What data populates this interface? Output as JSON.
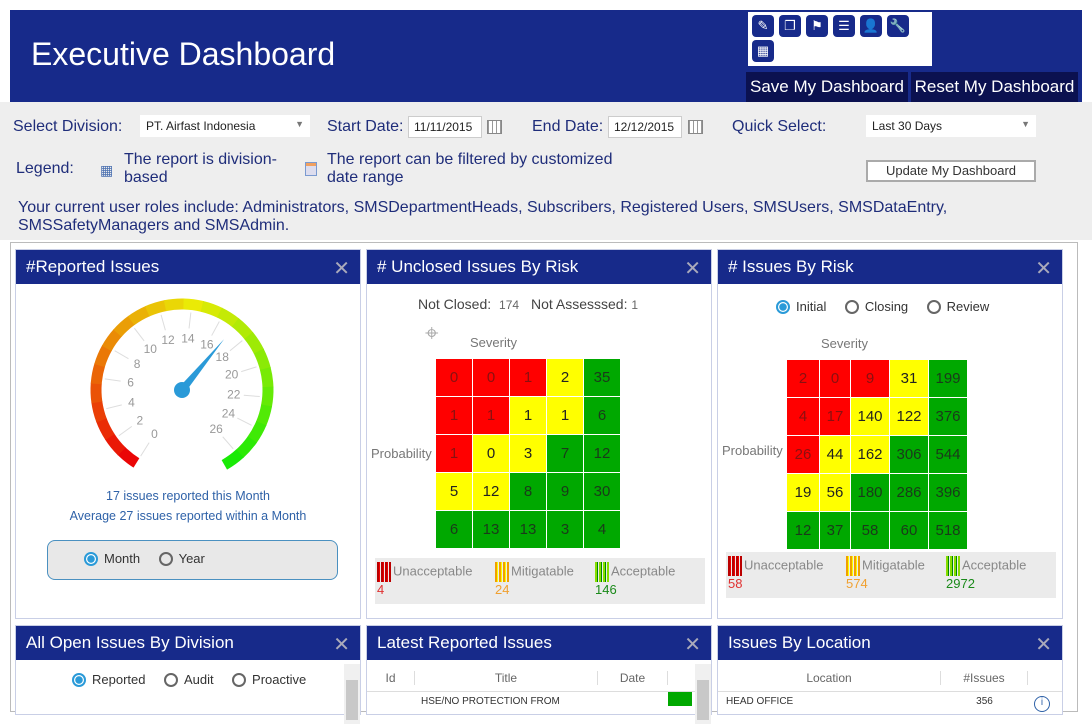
{
  "header": {
    "title": "Executive Dashboard",
    "save_label": "Save My Dashboard",
    "reset_label": "Reset My Dashboard",
    "toolbar_icons": [
      "edit-icon",
      "copy-icon",
      "flag-icon",
      "document-icon",
      "user-icon",
      "wrench-icon",
      "calendar-grid-icon"
    ]
  },
  "filters": {
    "division_label": "Select Division:",
    "division_value": "PT. Airfast Indonesia",
    "start_label": "Start Date:",
    "start_value": "11/11/2015",
    "end_label": "End Date:",
    "end_value": "12/12/2015",
    "quick_label": "Quick Select:",
    "quick_value": "Last 30 Days",
    "legend_label": "Legend:",
    "legend_division": "The report is division-based",
    "legend_date": "The report can be filtered by customized date range",
    "update_label": "Update My Dashboard",
    "roles_text": "Your current user roles include: Administrators, SMSDepartmentHeads, Subscribers, Registered Users, SMSUsers, SMSDataEntry, SMSSafetyManagers and SMSAdmin."
  },
  "reported": {
    "title": "#Reported Issues",
    "line1": "17 issues reported this Month",
    "line2": "Average 27 issues reported within a Month",
    "radios": [
      "Month",
      "Year"
    ],
    "selected": "Month"
  },
  "chart_data": [
    {
      "type": "gauge",
      "value": 17,
      "min": 0,
      "max": 27,
      "ticks": [
        "0",
        "2",
        "4",
        "6",
        "8",
        "10",
        "12",
        "14",
        "16",
        "18",
        "20",
        "22",
        "24",
        "26"
      ],
      "colors": [
        "#e00000",
        "#f0a000",
        "#e8e800",
        "#20d000"
      ]
    },
    {
      "type": "heatmap",
      "title": "# Unclosed Issues By Risk",
      "xlabel": "Severity",
      "ylabel": "Probability",
      "values": [
        [
          0,
          0,
          1,
          2,
          35
        ],
        [
          1,
          1,
          1,
          1,
          6
        ],
        [
          1,
          0,
          3,
          7,
          12
        ],
        [
          5,
          12,
          8,
          9,
          30
        ],
        [
          6,
          13,
          13,
          3,
          4
        ]
      ],
      "levels": [
        [
          "r",
          "r",
          "r",
          "y",
          "g"
        ],
        [
          "r",
          "r",
          "y",
          "y",
          "g"
        ],
        [
          "r",
          "y",
          "y",
          "g",
          "g"
        ],
        [
          "y",
          "y",
          "g",
          "g",
          "g"
        ],
        [
          "g",
          "g",
          "g",
          "g",
          "g"
        ]
      ]
    },
    {
      "type": "heatmap",
      "title": "# Issues By Risk",
      "xlabel": "Severity",
      "ylabel": "Probability",
      "values": [
        [
          2,
          0,
          9,
          31,
          199
        ],
        [
          4,
          17,
          140,
          122,
          376
        ],
        [
          26,
          44,
          162,
          306,
          544
        ],
        [
          19,
          56,
          180,
          286,
          396
        ],
        [
          12,
          37,
          58,
          60,
          518
        ]
      ],
      "levels": [
        [
          "r",
          "r",
          "r",
          "y",
          "g"
        ],
        [
          "r",
          "r",
          "y",
          "y",
          "g"
        ],
        [
          "r",
          "y",
          "y",
          "g",
          "g"
        ],
        [
          "y",
          "y",
          "g",
          "g",
          "g"
        ],
        [
          "g",
          "g",
          "g",
          "g",
          "g"
        ]
      ]
    }
  ],
  "unclosed": {
    "title": "# Unclosed Issues By Risk",
    "not_closed_label": "Not Closed:",
    "not_closed": "174",
    "not_assessed_label": "Not Assesssed:",
    "not_assessed": "1",
    "severity": "Severity",
    "probability": "Probability",
    "legend": [
      {
        "label": "Unacceptable",
        "value": "4"
      },
      {
        "label": "Mitigatable",
        "value": "24"
      },
      {
        "label": "Acceptable",
        "value": "146"
      }
    ]
  },
  "byrisk": {
    "title": "# Issues By Risk",
    "radios": [
      "Initial",
      "Closing",
      "Review"
    ],
    "selected": "Initial",
    "severity": "Severity",
    "probability": "Probability",
    "legend": [
      {
        "label": "Unacceptable",
        "value": "58"
      },
      {
        "label": "Mitigatable",
        "value": "574"
      },
      {
        "label": "Acceptable",
        "value": "2972"
      }
    ]
  },
  "division": {
    "title": "All Open Issues By Division",
    "radios": [
      "Reported",
      "Audit",
      "Proactive"
    ],
    "selected": "Reported"
  },
  "latest": {
    "title": "Latest Reported Issues",
    "columns": [
      "Id",
      "Title",
      "Date"
    ],
    "rows": [
      {
        "title": "HSE/NO PROTECTION FROM"
      }
    ]
  },
  "location": {
    "title": "Issues By Location",
    "columns": [
      "Location",
      "#Issues"
    ],
    "rows": [
      {
        "location": "HEAD OFFICE",
        "issues": "356"
      }
    ]
  },
  "colors": {
    "header": "#172a8a",
    "red": "#ff0000",
    "yellow": "#ffff00",
    "green": "#00a800",
    "accent": "#2a9ad8"
  }
}
